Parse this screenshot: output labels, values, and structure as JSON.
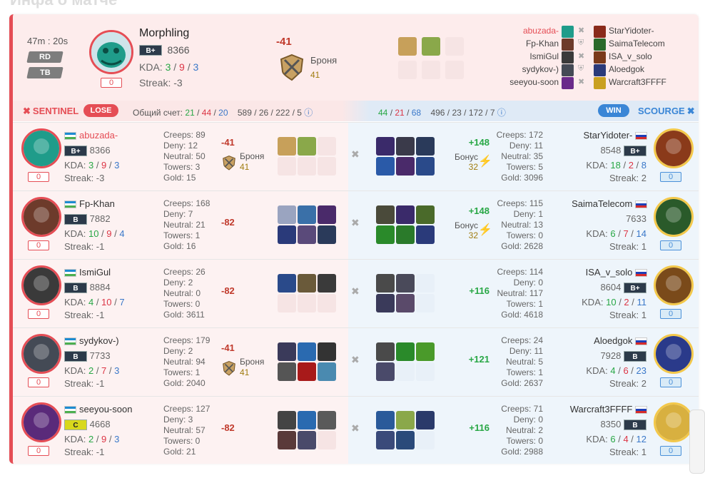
{
  "page_heading": "Инфа о матче",
  "header": {
    "duration": "47m : 20s",
    "tag1": "RD",
    "tag2": "TB",
    "hero_name": "Morphling",
    "rank": "B+",
    "mmr": "8366",
    "kda_label": "KDA:",
    "kda_k": "3",
    "kda_d": "9",
    "kda_a": "3",
    "streak": "Streak: -3",
    "zero": "0",
    "delta": "-41",
    "armor_label": "Броня",
    "armor_value": "41",
    "sentinel_players": [
      "abuzada-",
      "Fp-Khan",
      "IsmiGul",
      "sydykov-)",
      "seeyou-soon"
    ],
    "scourge_players": [
      "StarYidoter-",
      "SaimaTelecom",
      "ISA_v_solo",
      "Aloedgok",
      "Warcraft3FFFF"
    ]
  },
  "teambar": {
    "sentinel": "SENTINEL",
    "lose": "LOSE",
    "score_label": "Общий счет:",
    "s_k": "21",
    "s_d": "44",
    "s_a": "20",
    "s_stats": "589 / 26 / 222 / 5",
    "c_k": "44",
    "c_d": "21",
    "c_a": "68",
    "c_stats": "496 / 23 / 172 / 7",
    "win": "WIN",
    "scourge": "SCOURGE"
  },
  "colors": {
    "sentinel": "#e54d55",
    "scourge": "#4a90d9",
    "win": "#3a86d6",
    "lose": "#e54d55"
  },
  "rows": [
    {
      "left": {
        "name": "abuzada-",
        "rank": "B+",
        "mmr": "8366",
        "k": "3",
        "d": "9",
        "a": "3",
        "streak": "Streak: -3",
        "zero": "0",
        "creeps": "Creeps: 89",
        "deny": "Deny: 12",
        "neutral": "Neutral: 50",
        "towers": "Towers: 3",
        "gold": "Gold: 15",
        "delta": "-41",
        "armor_label": "Броня",
        "armor_value": "41"
      },
      "right": {
        "name": "StarYidoter-",
        "rank": "B+",
        "mmr": "8548",
        "k": "18",
        "d": "2",
        "a": "8",
        "streak": "Streak: 2",
        "zero": "0",
        "creeps": "Creeps: 172",
        "deny": "Deny: 11",
        "neutral": "Neutral: 35",
        "towers": "Towers: 5",
        "gold": "Gold: 3096",
        "gain": "+148",
        "bonus_label": "Бонус",
        "bonus_value": "32"
      }
    },
    {
      "left": {
        "name": "Fp-Khan",
        "rank": "B",
        "mmr": "7882",
        "k": "10",
        "d": "9",
        "a": "4",
        "streak": "Streak: -1",
        "zero": "0",
        "creeps": "Creeps: 168",
        "deny": "Deny: 7",
        "neutral": "Neutral: 21",
        "towers": "Towers: 1",
        "gold": "Gold: 16",
        "delta": "-82"
      },
      "right": {
        "name": "SaimaTelecom",
        "rank": "",
        "mmr": "7633",
        "k": "6",
        "d": "7",
        "a": "14",
        "streak": "Streak: 1",
        "zero": "0",
        "creeps": "Creeps: 115",
        "deny": "Deny: 1",
        "neutral": "Neutral: 13",
        "towers": "Towers: 0",
        "gold": "Gold: 2628",
        "gain": "+148",
        "bonus_label": "Бонус",
        "bonus_value": "32"
      }
    },
    {
      "left": {
        "name": "IsmiGul",
        "rank": "B",
        "mmr": "8884",
        "k": "4",
        "d": "10",
        "a": "7",
        "streak": "Streak: -1",
        "zero": "0",
        "creeps": "Creeps: 26",
        "deny": "Deny: 2",
        "neutral": "Neutral: 0",
        "towers": "Towers: 0",
        "gold": "Gold: 3611",
        "delta": "-82"
      },
      "right": {
        "name": "ISA_v_solo",
        "rank": "B+",
        "mmr": "8604",
        "k": "10",
        "d": "2",
        "a": "11",
        "streak": "Streak: 1",
        "zero": "0",
        "creeps": "Creeps: 114",
        "deny": "Deny: 0",
        "neutral": "Neutral: 117",
        "towers": "Towers: 1",
        "gold": "Gold: 4618",
        "gain": "+116"
      }
    },
    {
      "left": {
        "name": "sydykov-)",
        "rank": "B",
        "mmr": "7733",
        "k": "2",
        "d": "7",
        "a": "3",
        "streak": "Streak: -1",
        "zero": "0",
        "creeps": "Creeps: 179",
        "deny": "Deny: 2",
        "neutral": "Neutral: 94",
        "towers": "Towers: 1",
        "gold": "Gold: 2040",
        "delta": "-41",
        "armor_label": "Броня",
        "armor_value": "41"
      },
      "right": {
        "name": "Aloedgok",
        "rank": "B",
        "mmr": "7928",
        "k": "4",
        "d": "6",
        "a": "23",
        "streak": "Streak: 2",
        "zero": "0",
        "creeps": "Creeps: 24",
        "deny": "Deny: 11",
        "neutral": "Neutral: 5",
        "towers": "Towers: 1",
        "gold": "Gold: 2637",
        "gain": "+121"
      }
    },
    {
      "left": {
        "name": "seeyou-soon",
        "rank": "C",
        "mmr": "4668",
        "k": "2",
        "d": "9",
        "a": "3",
        "streak": "Streak: -1",
        "zero": "0",
        "creeps": "Creeps: 127",
        "deny": "Deny: 3",
        "neutral": "Neutral: 57",
        "towers": "Towers: 0",
        "gold": "Gold: 21",
        "delta": "-82"
      },
      "right": {
        "name": "Warcraft3FFFF",
        "rank": "B",
        "mmr": "8350",
        "k": "6",
        "d": "4",
        "a": "12",
        "streak": "Streak: 1",
        "zero": "0",
        "creeps": "Creeps: 71",
        "deny": "Deny: 0",
        "neutral": "Neutral: 2",
        "towers": "Towers: 0",
        "gold": "Gold: 2988",
        "gain": "+116"
      }
    }
  ]
}
